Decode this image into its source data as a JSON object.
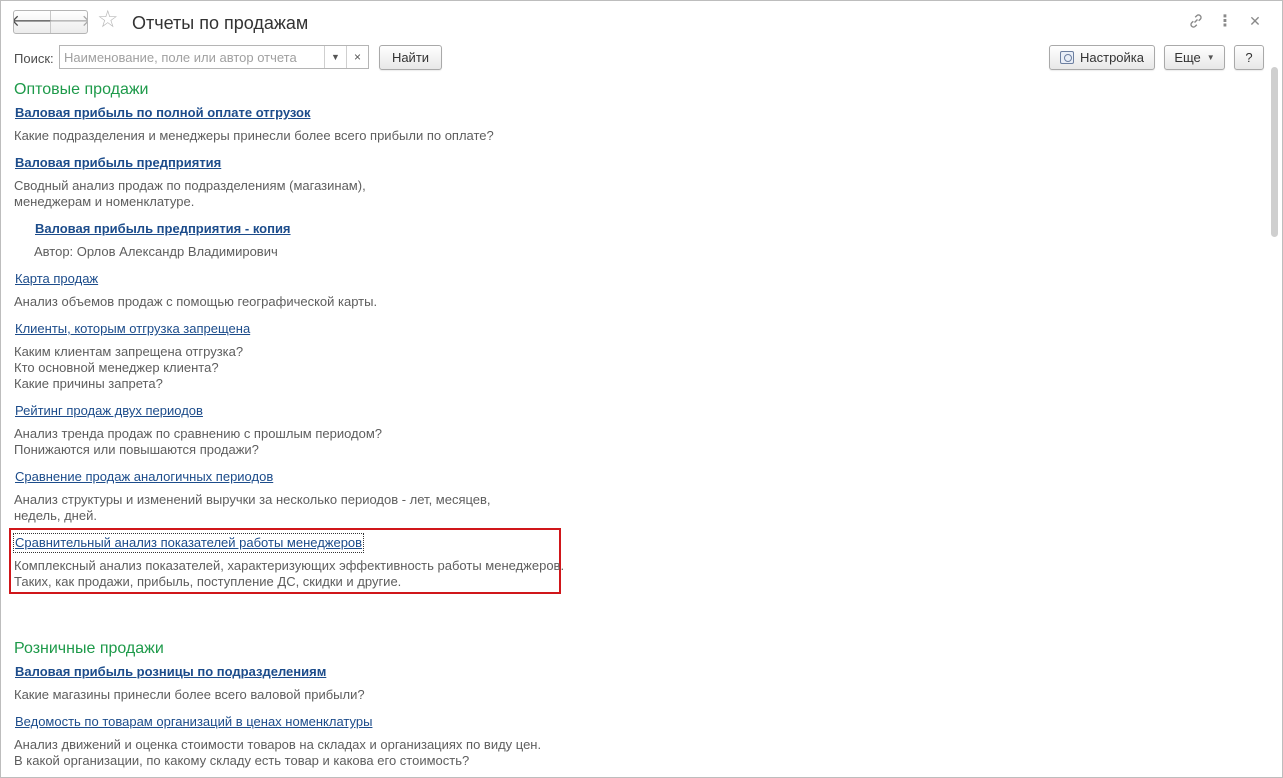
{
  "window": {
    "title": "Отчеты по продажам",
    "back_glyph": "🡐",
    "forward_glyph": "🡒"
  },
  "icons": {
    "star": "star-icon",
    "link": "link-icon",
    "more": "more-vertical-icon",
    "close": "close-icon",
    "settings": "settings-icon",
    "dropdown": "chevron-down-icon",
    "clear": "clear-icon"
  },
  "toolbar": {
    "search_label": "Поиск:",
    "search_placeholder": "Наименование, поле или автор отчета",
    "search_value": "",
    "find_label": "Найти",
    "settings_label": "Настройка",
    "more_label": "Еще",
    "help_label": "?"
  },
  "sections": [
    {
      "title": "Оптовые продажи",
      "reports": [
        {
          "name": "Валовая прибыль по полной оплате отгрузок",
          "bold": true,
          "description": [
            "Какие подразделения и менеджеры принесли более всего прибыли по оплате?"
          ]
        },
        {
          "name": "Валовая прибыль предприятия",
          "bold": true,
          "description": [
            "Сводный анализ продаж по подразделениям (магазинам),",
            "менеджерам и номенклатуре."
          ]
        },
        {
          "name": "Валовая прибыль предприятия - копия",
          "bold": true,
          "indent": true,
          "description": [
            "Автор: Орлов Александр Владимирович"
          ]
        },
        {
          "name": "Карта продаж",
          "bold": false,
          "description": [
            "Анализ объемов продаж с помощью географической карты."
          ]
        },
        {
          "name": "Клиенты, которым отгрузка запрещена",
          "bold": false,
          "description": [
            "Каким клиентам запрещена отгрузка?",
            "Кто основной менеджер клиента?",
            "Какие причины запрета?"
          ]
        },
        {
          "name": "Рейтинг продаж двух периодов",
          "bold": false,
          "description": [
            "Анализ тренда продаж по сравнению с прошлым периодом?",
            "Понижаются или повышаются продажи?"
          ]
        },
        {
          "name": "Сравнение продаж аналогичных периодов",
          "bold": false,
          "description": [
            "Анализ структуры и изменений выручки за несколько периодов - лет, месяцев,",
            "недель, дней."
          ]
        },
        {
          "name": "Сравнительный анализ показателей работы менеджеров",
          "bold": false,
          "highlighted": true,
          "description": [
            "Комплексный анализ показателей, характеризующих эффективность работы менеджеров.",
            "Таких, как продажи, прибыль, поступление ДС, скидки и другие."
          ]
        }
      ]
    },
    {
      "title": "Розничные продажи",
      "reports": [
        {
          "name": "Валовая прибыль розницы по подразделениям",
          "bold": true,
          "description": [
            "Какие магазины принесли более всего валовой прибыли?"
          ]
        },
        {
          "name": "Ведомость по товарам организаций в ценах номенклатуры",
          "bold": false,
          "description": [
            "Анализ движений и оценка стоимости товаров на складах и организациях по виду цен.",
            "В какой организации, по какому складу есть товар и какова его стоимость?"
          ]
        }
      ]
    }
  ],
  "colors": {
    "section_title": "#1e9a4a",
    "link": "#1c4c8b",
    "description": "#5e5e5e",
    "highlight": "#d0161a"
  }
}
